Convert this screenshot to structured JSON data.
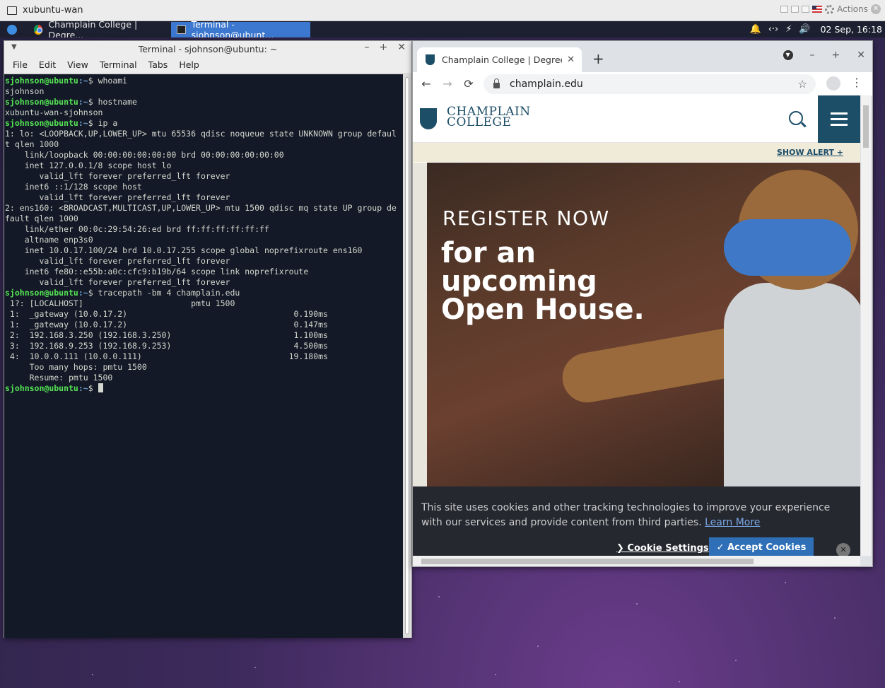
{
  "vm": {
    "title": "xubuntu-wan",
    "actions_label": "Actions"
  },
  "panel": {
    "tasks": [
      {
        "label": "Champlain College | Degre..."
      },
      {
        "label": "Terminal - sjohnson@ubunt..."
      }
    ],
    "clock": "02 Sep, 16:18"
  },
  "terminal": {
    "title": "Terminal - sjohnson@ubuntu: ~",
    "menu": [
      "File",
      "Edit",
      "View",
      "Terminal",
      "Tabs",
      "Help"
    ],
    "prompt_user": "sjohnson@ubuntu",
    "prompt_path": ":~",
    "lines": [
      {
        "type": "cmd",
        "text": "$ whoami"
      },
      {
        "type": "out",
        "text": "sjohnson"
      },
      {
        "type": "cmd",
        "text": "$ hostname"
      },
      {
        "type": "out",
        "text": "xubuntu-wan-sjohnson"
      },
      {
        "type": "cmd",
        "text": "$ ip a"
      },
      {
        "type": "out",
        "text": "1: lo: <LOOPBACK,UP,LOWER_UP> mtu 65536 qdisc noqueue state UNKNOWN group defaul"
      },
      {
        "type": "out",
        "text": "t qlen 1000"
      },
      {
        "type": "out",
        "text": "    link/loopback 00:00:00:00:00:00 brd 00:00:00:00:00:00"
      },
      {
        "type": "out",
        "text": "    inet 127.0.0.1/8 scope host lo"
      },
      {
        "type": "out",
        "text": "       valid_lft forever preferred_lft forever"
      },
      {
        "type": "out",
        "text": "    inet6 ::1/128 scope host"
      },
      {
        "type": "out",
        "text": "       valid_lft forever preferred_lft forever"
      },
      {
        "type": "out",
        "text": "2: ens160: <BROADCAST,MULTICAST,UP,LOWER_UP> mtu 1500 qdisc mq state UP group de"
      },
      {
        "type": "out",
        "text": "fault qlen 1000"
      },
      {
        "type": "out",
        "text": "    link/ether 00:0c:29:54:26:ed brd ff:ff:ff:ff:ff:ff"
      },
      {
        "type": "out",
        "text": "    altname enp3s0"
      },
      {
        "type": "out",
        "text": "    inet 10.0.17.100/24 brd 10.0.17.255 scope global noprefixroute ens160"
      },
      {
        "type": "out",
        "text": "       valid_lft forever preferred_lft forever"
      },
      {
        "type": "out",
        "text": "    inet6 fe80::e55b:a0c:cfc9:b19b/64 scope link noprefixroute"
      },
      {
        "type": "out",
        "text": "       valid_lft forever preferred_lft forever"
      },
      {
        "type": "cmd",
        "text": "$ tracepath -bm 4 champlain.edu"
      },
      {
        "type": "out",
        "text": " 1?: [LOCALHOST]                      pmtu 1500"
      },
      {
        "type": "out",
        "text": " 1:  _gateway (10.0.17.2)                                  0.190ms"
      },
      {
        "type": "out",
        "text": " 1:  _gateway (10.0.17.2)                                  0.147ms"
      },
      {
        "type": "out",
        "text": " 2:  192.168.3.250 (192.168.3.250)                         1.100ms"
      },
      {
        "type": "out",
        "text": " 3:  192.168.9.253 (192.168.9.253)                         4.500ms"
      },
      {
        "type": "out",
        "text": " 4:  10.0.0.111 (10.0.0.111)                              19.180ms"
      },
      {
        "type": "out",
        "text": "     Too many hops: pmtu 1500"
      },
      {
        "type": "out",
        "text": "     Resume: pmtu 1500"
      },
      {
        "type": "cmd_cursor",
        "text": "$ "
      }
    ]
  },
  "browser": {
    "tab_title": "Champlain College | Degree Pr",
    "url": "champlain.edu",
    "site": {
      "logo_line1": "CHAMPLAIN",
      "logo_line2": "COLLEGE",
      "alert_link": "SHOW ALERT +",
      "hero_kicker": "REGISTER NOW",
      "hero_line1": "for an",
      "hero_line2": "upcoming",
      "hero_line3": "Open House."
    },
    "cookie": {
      "text": "This site uses cookies and other tracking technologies to improve your experience with our services and provide content from third parties.",
      "learn_more": "Learn More",
      "settings": "❯ Cookie Settings",
      "accept": "✓ Accept Cookies"
    }
  }
}
